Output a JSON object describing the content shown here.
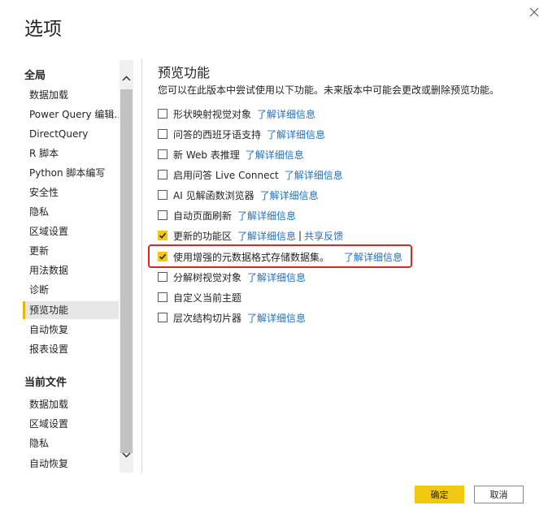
{
  "dialog": {
    "title": "选项",
    "close_icon": "close-icon"
  },
  "sidebar": {
    "global_header": "全局",
    "global_items": [
      {
        "label": "数据加载"
      },
      {
        "label": "Power Query 编辑..."
      },
      {
        "label": "DirectQuery"
      },
      {
        "label": "R 脚本"
      },
      {
        "label": "Python 脚本编写"
      },
      {
        "label": "安全性"
      },
      {
        "label": "隐私"
      },
      {
        "label": "区域设置"
      },
      {
        "label": "更新"
      },
      {
        "label": "用法数据"
      },
      {
        "label": "诊断"
      },
      {
        "label": "预览功能",
        "selected": true
      },
      {
        "label": "自动恢复"
      },
      {
        "label": "报表设置"
      }
    ],
    "file_header": "当前文件",
    "file_items": [
      {
        "label": "数据加载"
      },
      {
        "label": "区域设置"
      },
      {
        "label": "隐私"
      },
      {
        "label": "自动恢复"
      }
    ]
  },
  "content": {
    "title": "预览功能",
    "description": "您可以在此版本中尝试使用以下功能。未来版本中可能会更改或删除预览功能。",
    "options": [
      {
        "label": "形状映射视觉对象",
        "link": "了解详细信息",
        "checked": false
      },
      {
        "label": "问答的西班牙语支持",
        "link": "了解详细信息",
        "checked": false
      },
      {
        "label": "新 Web 表推理",
        "link": "了解详细信息",
        "checked": false
      },
      {
        "label": "启用问答 Live Connect",
        "link": "了解详细信息",
        "checked": false
      },
      {
        "label": "AI 见解函数浏览器",
        "link": "了解详细信息",
        "checked": false
      },
      {
        "label": "自动页面刷新",
        "link": "了解详细信息",
        "checked": false
      },
      {
        "label": "更新的功能区",
        "link": "了解详细信息",
        "separator": "|",
        "link2": "共享反馈",
        "checked": true
      },
      {
        "label": "使用增强的元数据格式存储数据集。",
        "link": "了解详细信息",
        "checked": true,
        "highlighted": true
      },
      {
        "label": "分解树视觉对象",
        "link": "了解详细信息",
        "checked": false
      },
      {
        "label": "自定义当前主题",
        "link": "",
        "checked": false
      },
      {
        "label": "层次结构切片器",
        "link": "了解详细信息",
        "checked": false
      }
    ]
  },
  "footer": {
    "ok_label": "确定",
    "cancel_label": "取消"
  },
  "colors": {
    "accent": "#f2c811",
    "link": "#1f6fc5",
    "highlight": "#e02424"
  }
}
